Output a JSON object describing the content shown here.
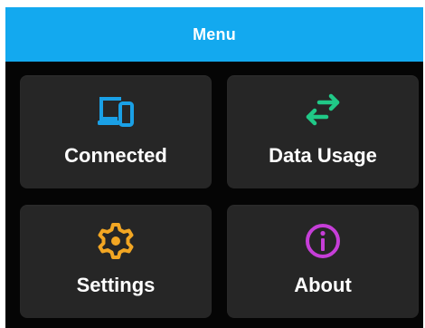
{
  "header": {
    "title": "Menu",
    "color": "#13a9ef"
  },
  "tiles": [
    {
      "label": "Connected",
      "icon": "devices-icon",
      "icon_color": "#1aa0e6"
    },
    {
      "label": "Data Usage",
      "icon": "swap-arrows-icon",
      "icon_color": "#20c987"
    },
    {
      "label": "Settings",
      "icon": "gear-icon",
      "icon_color": "#f2a623"
    },
    {
      "label": "About",
      "icon": "info-icon",
      "icon_color": "#c63ed8"
    }
  ]
}
